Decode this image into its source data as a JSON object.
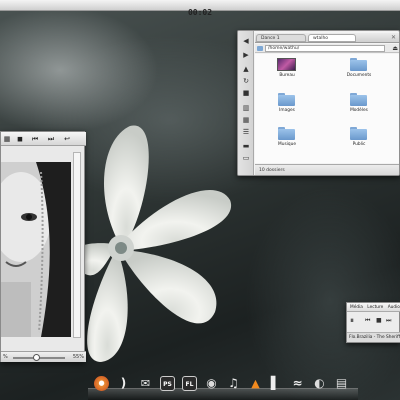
{
  "menubar": {
    "clock": "00:02"
  },
  "file_manager": {
    "tabs": [
      "Dance 1",
      "wtalho"
    ],
    "close_glyph": "✕",
    "path": "/home/wathu/",
    "eject_glyph": "⏏",
    "items": [
      {
        "label": "Bureau",
        "icon": "desktop-thumbnail"
      },
      {
        "label": "Documents",
        "icon": "folder-icon"
      },
      {
        "label": "Images",
        "icon": "folder-icon"
      },
      {
        "label": "Modèles",
        "icon": "folder-icon"
      },
      {
        "label": "Musique",
        "icon": "folder-icon"
      },
      {
        "label": "Public",
        "icon": "folder-icon"
      }
    ],
    "status": "10 dossiers",
    "sidebar_glyphs": [
      "◀",
      "▶",
      "▲",
      "↻",
      "■",
      "▥",
      "▦",
      "☰",
      "▬",
      "▭"
    ]
  },
  "image_viewer": {
    "toolbar_glyphs": [
      "▦",
      "◼",
      "⏮",
      "⏭",
      "↩"
    ],
    "zoom_left": "%",
    "zoom_right": "55%"
  },
  "audio_player": {
    "menu": [
      "Média",
      "Lecture",
      "Audio"
    ],
    "controls": [
      "⏸",
      "⏮",
      "■",
      "⏭"
    ],
    "track": "Flo.Brazilia - The Sheriff"
  },
  "dock": {
    "items": [
      {
        "name": "firefox-icon",
        "glyph": "●"
      },
      {
        "name": "rss-icon",
        "glyph": ")"
      },
      {
        "name": "mail-icon",
        "glyph": "✉"
      },
      {
        "name": "photoshop-icon",
        "glyph": "PS"
      },
      {
        "name": "illustrator-icon",
        "glyph": "FL"
      },
      {
        "name": "world-icon",
        "glyph": "◉"
      },
      {
        "name": "music-icon",
        "glyph": "♫"
      },
      {
        "name": "vlc-icon",
        "glyph": "▲"
      },
      {
        "name": "book-icon",
        "glyph": "▌"
      },
      {
        "name": "tools-icon",
        "glyph": "≈"
      },
      {
        "name": "settings-icon",
        "glyph": "◐"
      },
      {
        "name": "drive-icon",
        "glyph": "▤"
      }
    ]
  }
}
